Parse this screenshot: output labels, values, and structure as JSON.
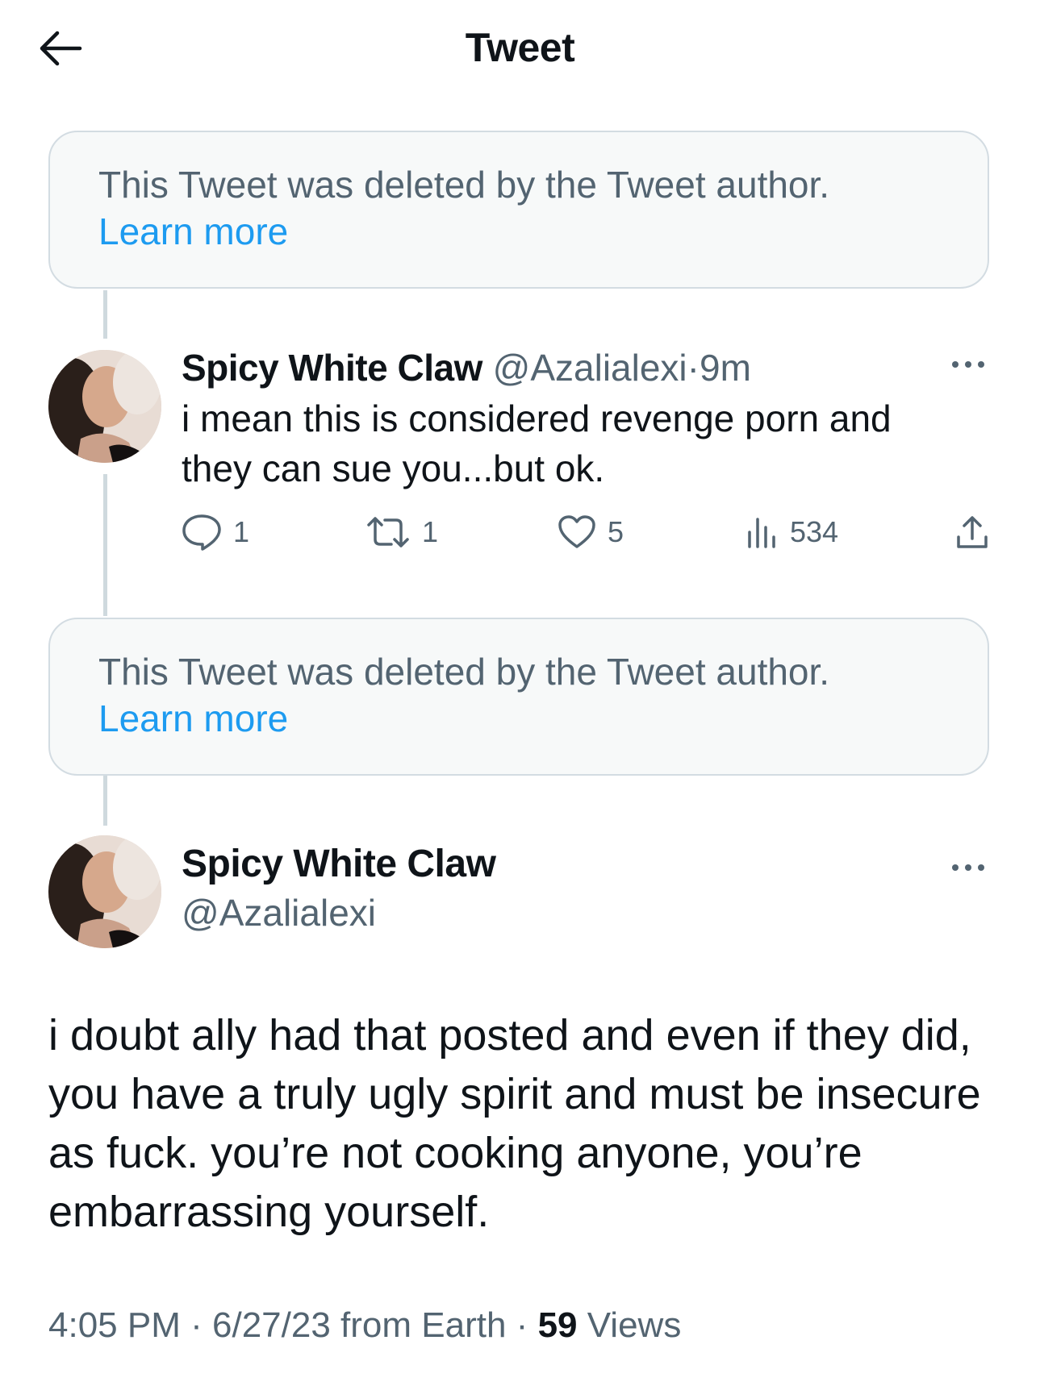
{
  "header": {
    "title": "Tweet",
    "back_icon": "arrow-left-icon"
  },
  "deleted_notice_1": {
    "text": "This Tweet was deleted by the Tweet author.",
    "link": "Learn more"
  },
  "reply_tweet": {
    "name": "Spicy White Claw",
    "handle": "@Azalialexi",
    "separator": "·",
    "time": "9m",
    "text": "i mean this is considered revenge porn and they can sue you...but ok.",
    "stats": {
      "replies": "1",
      "retweets": "1",
      "likes": "5",
      "views": "534"
    }
  },
  "deleted_notice_2": {
    "text": "This Tweet was deleted by the Tweet author.",
    "link": "Learn more"
  },
  "main_tweet": {
    "name": "Spicy White Claw",
    "handle": "@Azalialexi",
    "text": "i doubt ally had that posted and even if they did, you have a truly ugly spirit and must be insecure as fuck. you’re not cooking anyone, you’re embarrassing yourself.",
    "time": "4:05 PM",
    "date": "6/27/23",
    "source": "from Earth",
    "dot": "·",
    "views_count": "59",
    "views_label": "Views"
  },
  "colors": {
    "text": "#0f1419",
    "secondary": "#536471",
    "link": "#1d9bf0",
    "notice_bg": "#f7f9f9",
    "notice_border": "#d3dce2",
    "thread_line": "#cfd9de"
  }
}
